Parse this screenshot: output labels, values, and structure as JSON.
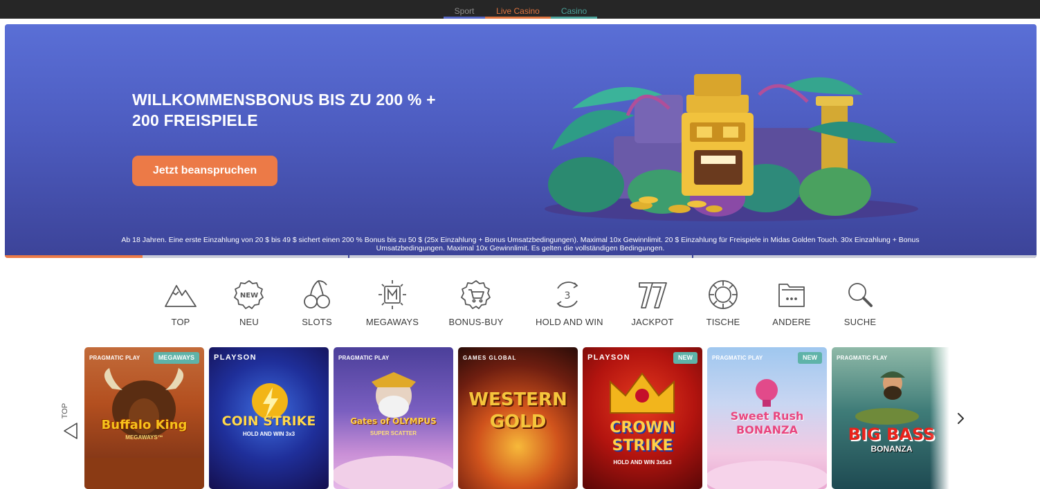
{
  "topnav": {
    "tabs": [
      {
        "label": "Sport",
        "color": "#5667c6"
      },
      {
        "label": "Live Casino",
        "color": "#e0743f"
      },
      {
        "label": "Casino",
        "color": "#4aa39b"
      }
    ]
  },
  "hero": {
    "title_line1": "WILLKOMMENSBONUS BIS ZU 200 % +",
    "title_line2": "200 FREISPIELE",
    "cta_label": "Jetzt beanspruchen",
    "disclaimer": "Ab 18 Jahren. Eine erste Einzahlung von 20 $ bis 49 $ sichert einen 200 % Bonus bis zu 50 $ (25x Einzahlung + Bonus Umsatzbedingungen). Maximal 10x Gewinnlimit. 20 $ Einzahlung für Freispiele in Midas Golden Touch. 30x Einzahlung + Bonus Umsatzbedingungen. Maximal 10x Gewinnlimit. Es gelten die vollständigen Bedingungen.",
    "slides_total": 3,
    "current_slide": 1,
    "current_slide_progress": 0.4,
    "progress_color": "#ec7a47"
  },
  "categories": [
    {
      "label": "TOP",
      "icon": "mountain-icon"
    },
    {
      "label": "NEU",
      "icon": "new-badge-icon"
    },
    {
      "label": "SLOTS",
      "icon": "cherries-icon"
    },
    {
      "label": "MEGAWAYS",
      "icon": "megaways-icon"
    },
    {
      "label": "BONUS-BUY",
      "icon": "cart-badge-icon"
    },
    {
      "label": "HOLD AND WIN",
      "icon": "hold-and-win-icon"
    },
    {
      "label": "JACKPOT",
      "icon": "seven-icon"
    },
    {
      "label": "TISCHE",
      "icon": "chip-icon"
    },
    {
      "label": "ANDERE",
      "icon": "folder-icon"
    },
    {
      "label": "SUCHE",
      "icon": "search-icon"
    }
  ],
  "games": {
    "top_label": "TOP",
    "items": [
      {
        "provider": "PRAGMATIC PLAY",
        "badge": "MEGAWAYS",
        "title": "Buffalo King",
        "subtitle": "MEGAWAYS™"
      },
      {
        "provider": "PLAYSON",
        "badge": "",
        "title": "COIN STRIKE",
        "subtitle": "HOLD AND WIN 3x3"
      },
      {
        "provider": "PRAGMATIC PLAY",
        "badge": "",
        "title": "Gates of OLYMPUS",
        "subtitle": "SUPER SCATTER"
      },
      {
        "provider": "GAMES GLOBAL",
        "badge": "",
        "title": "WESTERN GOLD",
        "subtitle": ""
      },
      {
        "provider": "PLAYSON",
        "badge": "NEW",
        "title": "CROWN STRIKE",
        "subtitle": "HOLD AND WIN 3x5x3"
      },
      {
        "provider": "PRAGMATIC PLAY",
        "badge": "NEW",
        "title": "Sweet Rush BONANZA",
        "subtitle": ""
      },
      {
        "provider": "PRAGMATIC PLAY",
        "badge": "",
        "title": "BIG BASS",
        "subtitle": "BONANZA"
      }
    ]
  }
}
